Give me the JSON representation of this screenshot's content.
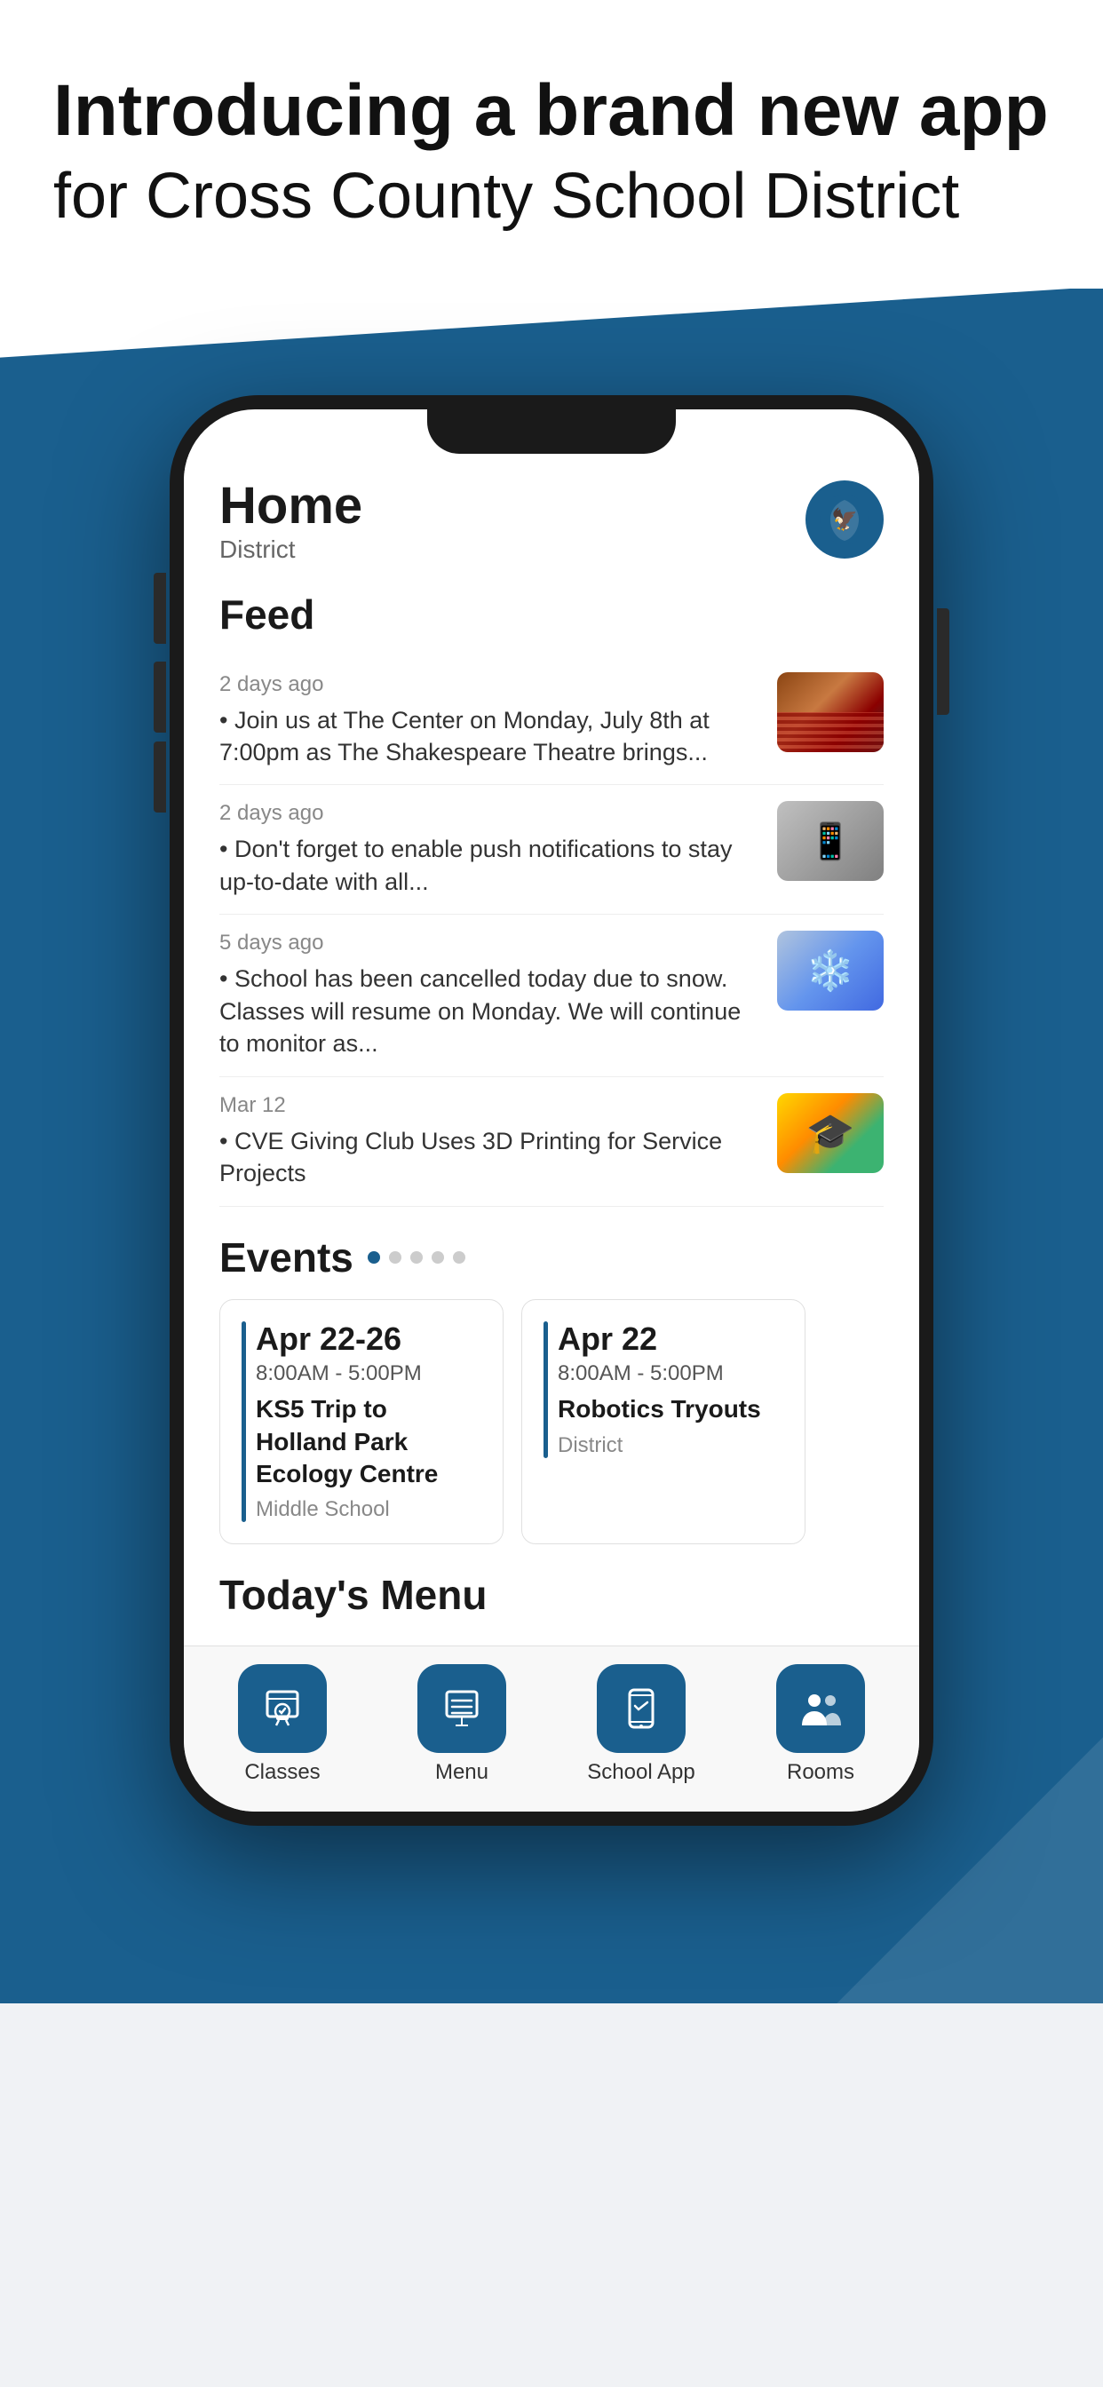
{
  "header": {
    "headline": "Introducing a brand new app",
    "subheadline": "for Cross County School District"
  },
  "phone": {
    "screen": {
      "title": "Home",
      "subtitle": "District",
      "feed_section_label": "Feed",
      "feed_items": [
        {
          "time": "2 days ago",
          "description": "• Join us at The Center on Monday, July 8th at 7:00pm as The Shakespeare Theatre brings...",
          "image_type": "theatre"
        },
        {
          "time": "2 days ago",
          "description": "• Don't forget to enable push notifications to stay up-to-date with all...",
          "image_type": "phone"
        },
        {
          "time": "5 days ago",
          "description": "• School has been cancelled today due to snow. Classes will resume on Monday. We will continue to monitor as...",
          "image_type": "snow"
        },
        {
          "time": "Mar 12",
          "description": "• CVE Giving Club Uses 3D Printing for Service Projects",
          "image_type": "students"
        }
      ],
      "events_section_label": "Events",
      "events": [
        {
          "date": "Apr 22-26",
          "time": "8:00AM  -  5:00PM",
          "name": "KS5 Trip to Holland Park Ecology Centre",
          "location": "Middle School"
        },
        {
          "date": "Apr 22",
          "time": "8:00AM  -  5:00PM",
          "name": "Robotics Tryouts",
          "location": "District"
        }
      ],
      "menu_section_label": "Today's Menu",
      "nav_items": [
        {
          "label": "Classes",
          "icon": "classes"
        },
        {
          "label": "Menu",
          "icon": "menu"
        },
        {
          "label": "School App",
          "icon": "school-app"
        },
        {
          "label": "Rooms",
          "icon": "rooms"
        }
      ]
    }
  }
}
